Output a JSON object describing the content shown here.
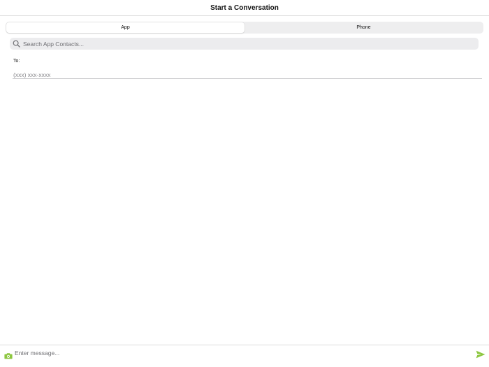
{
  "header": {
    "title": "Start a Conversation"
  },
  "tabs": {
    "items": [
      {
        "label": "App",
        "selected": true
      },
      {
        "label": "Phone",
        "selected": false
      }
    ]
  },
  "search": {
    "placeholder": "Search App Contacts...",
    "value": "",
    "icon": "search-icon"
  },
  "recipient": {
    "label": "To:",
    "placeholder": "(xxx) xxx-xxxx",
    "value": ""
  },
  "composer": {
    "placeholder": "Enter message...",
    "value": "",
    "camera_icon": "camera-icon",
    "send_icon": "send-icon"
  },
  "colors": {
    "accent": "#8cc63f",
    "segment_bg": "#eeeeef",
    "search_bg": "#ececee"
  }
}
